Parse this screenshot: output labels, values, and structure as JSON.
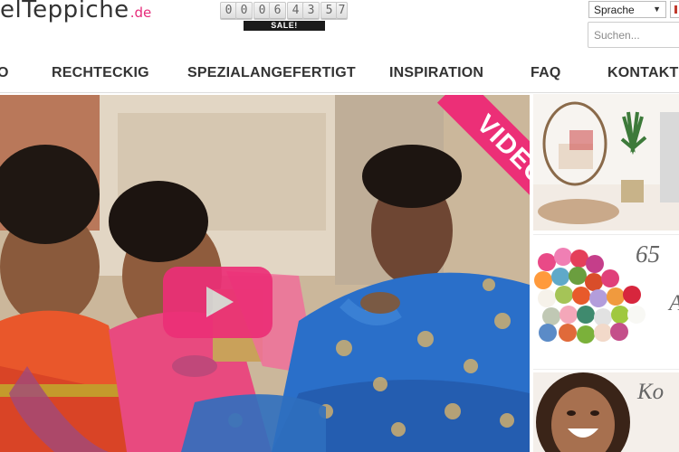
{
  "header": {
    "logo_main": "elTeppiche",
    "logo_tld": ".de",
    "countdown": {
      "digits": [
        "0",
        "0",
        "0",
        "6",
        "4",
        "3",
        "5",
        "7"
      ],
      "sale_label": "SALE!"
    },
    "language_select": {
      "selected": "Sprache"
    },
    "search": {
      "placeholder": "Suchen..."
    }
  },
  "nav": {
    "items": [
      {
        "label": "O"
      },
      {
        "label": "RECHTECKIG"
      },
      {
        "label": "SPEZIALANGEFERTIGT"
      },
      {
        "label": "INSPIRATION"
      },
      {
        "label": "FAQ"
      },
      {
        "label": "KONTAKT"
      }
    ]
  },
  "hero": {
    "ribbon_label": "VIDEO",
    "colors": {
      "accent": "#ec2f77",
      "blue_dress": "#2a6fc9",
      "pink_dress": "#e84a7f",
      "orange_dress": "#e9572b"
    }
  },
  "tiles": {
    "tile2_text": "65",
    "tile2_text2": "A",
    "tile3_text": "Ko"
  }
}
